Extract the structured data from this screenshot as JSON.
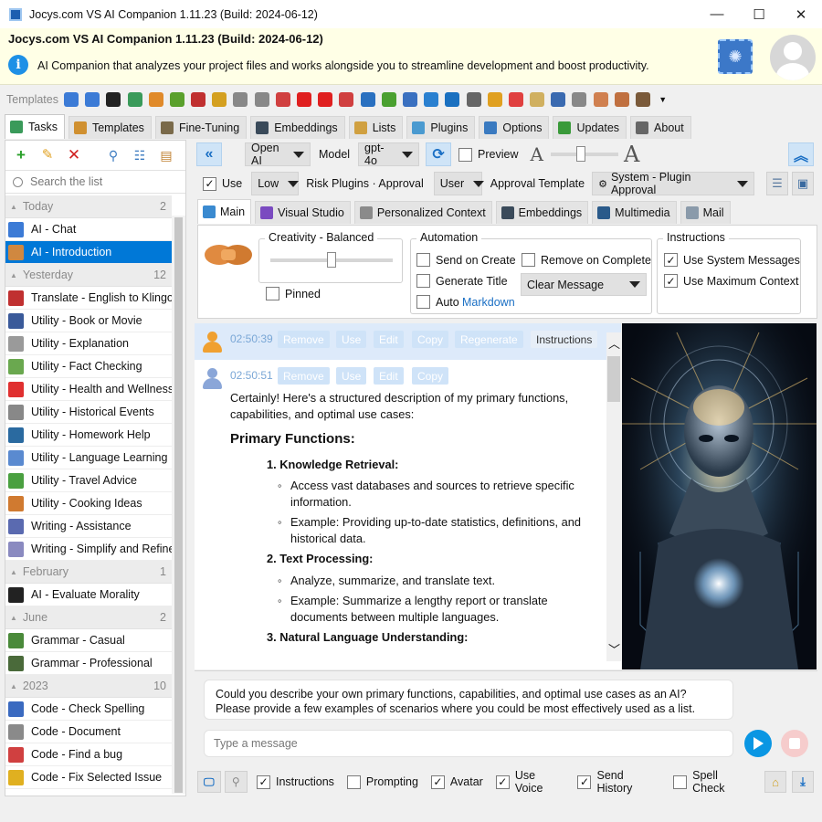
{
  "window": {
    "title": "Jocys.com VS AI Companion 1.11.23 (Build: 2024-06-12)",
    "minimize": "—",
    "maximize": "☐",
    "close": "✕"
  },
  "header": {
    "title": "Jocys.com VS AI Companion 1.11.23 (Build: 2024-06-12)",
    "info_glyph": "i",
    "description": "AI Companion that analyzes your project files and works alongside you to streamline development and boost productivity."
  },
  "templates_bar": {
    "label": "Templates",
    "icon_colors": [
      "#3c7bd6",
      "#3c7bd6",
      "#222222",
      "#3a9a5a",
      "#e08a2a",
      "#5aa02c",
      "#c03030",
      "#d4a020",
      "#888888",
      "#888888",
      "#d04040",
      "#e02020",
      "#e02020",
      "#d04040",
      "#2a70c0",
      "#4aa030",
      "#3a70c0",
      "#2a80d0",
      "#1a70c0",
      "#666666",
      "#e0a020",
      "#e04040",
      "#d0b060",
      "#3a6ab0",
      "#888888",
      "#d08050",
      "#c07040",
      "#7a5a3a"
    ],
    "more": "▼"
  },
  "top_tabs": [
    {
      "label": "Tasks",
      "color": "#3a9a5a"
    },
    {
      "label": "Templates",
      "color": "#d09030"
    },
    {
      "label": "Fine-Tuning",
      "color": "#7a6a4a"
    },
    {
      "label": "Embeddings",
      "color": "#3a4a5a"
    },
    {
      "label": "Lists",
      "color": "#d0a040"
    },
    {
      "label": "Plugins",
      "color": "#4a9ad0"
    },
    {
      "label": "Options",
      "color": "#3a7ac0"
    },
    {
      "label": "Updates",
      "color": "#3a9a3a"
    },
    {
      "label": "About",
      "color": "#666666"
    }
  ],
  "left_panel": {
    "search_placeholder": "Search the list",
    "groups": [
      {
        "name": "Today",
        "count": "2",
        "items": [
          {
            "label": "AI - Chat",
            "color": "#3c7bd6",
            "selected": false
          },
          {
            "label": "AI - Introduction",
            "color": "#d08840",
            "selected": true
          }
        ]
      },
      {
        "name": "Yesterday",
        "count": "12",
        "items": [
          {
            "label": "Translate - English to Klingon",
            "color": "#c03030"
          },
          {
            "label": "Utility - Book or Movie",
            "color": "#3a5a9a"
          },
          {
            "label": "Utility - Explanation",
            "color": "#9a9a9a"
          },
          {
            "label": "Utility - Fact Checking",
            "color": "#6aa84f"
          },
          {
            "label": "Utility - Health and Wellness",
            "color": "#e03030"
          },
          {
            "label": "Utility - Historical Events",
            "color": "#888888"
          },
          {
            "label": "Utility - Homework Help",
            "color": "#2a6aa0"
          },
          {
            "label": "Utility - Language Learning",
            "color": "#5a8ad0"
          },
          {
            "label": "Utility - Travel Advice",
            "color": "#4aa040"
          },
          {
            "label": "Utility - Cooking Ideas",
            "color": "#d07a30"
          },
          {
            "label": "Writing - Assistance",
            "color": "#5a6ab0"
          },
          {
            "label": "Writing - Simplify and Refine",
            "color": "#8a8ac0"
          }
        ]
      },
      {
        "name": "February",
        "count": "1",
        "items": [
          {
            "label": "AI - Evaluate Morality",
            "color": "#222222"
          }
        ]
      },
      {
        "name": "June",
        "count": "2",
        "items": [
          {
            "label": "Grammar - Casual",
            "color": "#4a8a3a"
          },
          {
            "label": "Grammar - Professional",
            "color": "#4a6a3a"
          }
        ]
      },
      {
        "name": "2023",
        "count": "10",
        "items": [
          {
            "label": "Code - Check Spelling",
            "color": "#3a6ac0"
          },
          {
            "label": "Code - Document",
            "color": "#8a8a8a"
          },
          {
            "label": "Code - Find a bug",
            "color": "#d04040"
          },
          {
            "label": "Code - Fix Selected Issue",
            "color": "#e0b020"
          }
        ]
      }
    ]
  },
  "toolbar": {
    "provider": "Open AI",
    "model_label": "Model",
    "model": "gpt-4o",
    "preview_label": "Preview",
    "use_label": "Use",
    "risk_level": "Low",
    "risk_label": "Risk Plugins · Approval",
    "approval": "User",
    "approval_template_label": "Approval Template",
    "approval_template": "System - Plugin Approval"
  },
  "sub_tabs": [
    {
      "label": "Main",
      "color": "#3a8ad0"
    },
    {
      "label": "Visual Studio",
      "color": "#7a4ac0"
    },
    {
      "label": "Personalized Context",
      "color": "#8a8a8a"
    },
    {
      "label": "Embeddings",
      "color": "#3a4a5a"
    },
    {
      "label": "Multimedia",
      "color": "#2a5a8a"
    },
    {
      "label": "Mail",
      "color": "#8a9aaa"
    }
  ],
  "main_panel": {
    "creativity_label": "Creativity - Balanced",
    "creativity_value": 0.5,
    "pinned_label": "Pinned",
    "automation_label": "Automation",
    "send_on_create": "Send on Create",
    "remove_on_complete": "Remove on Complete",
    "generate_title": "Generate Title",
    "clear_message": "Clear Message",
    "auto_label": "Auto",
    "markdown_link": "Markdown",
    "instructions_label": "Instructions",
    "use_system_messages": "Use System Messages",
    "use_max_context": "Use Maximum Context"
  },
  "chat": {
    "msg1": {
      "time": "02:50:39",
      "actions": [
        "Remove",
        "Use",
        "Edit",
        "Copy",
        "Regenerate"
      ],
      "instructions": "Instructions"
    },
    "msg2": {
      "time": "02:50:51",
      "actions": [
        "Remove",
        "Use",
        "Edit",
        "Copy"
      ]
    },
    "intro": "Certainly! Here's a structured description of my primary functions, capabilities, and optimal use cases:",
    "heading": "Primary Functions:",
    "sections": [
      {
        "num": "1.",
        "title": "Knowledge Retrieval:",
        "bullets": [
          "Access vast databases and sources to retrieve specific information.",
          "Example: Providing up-to-date statistics, definitions, and historical data."
        ]
      },
      {
        "num": "2.",
        "title": "Text Processing:",
        "bullets": [
          "Analyze, summarize, and translate text.",
          "Example: Summarize a lengthy report or translate documents between multiple languages."
        ]
      },
      {
        "num": "3.",
        "title": "Natural Language Understanding:",
        "bullets": []
      }
    ],
    "scroll_up": "︿",
    "scroll_down": "﹀"
  },
  "input": {
    "prompt_text": "Could you describe your own primary functions, capabilities, and optimal use cases as an AI? Please provide a few examples of scenarios where you could be most effectively used as a list.",
    "placeholder": "Type a message"
  },
  "bottom_options": {
    "instructions": "Instructions",
    "prompting": "Prompting",
    "avatar": "Avatar",
    "use_voice": "Use Voice",
    "send_history": "Send History",
    "spell_check": "Spell Check"
  }
}
